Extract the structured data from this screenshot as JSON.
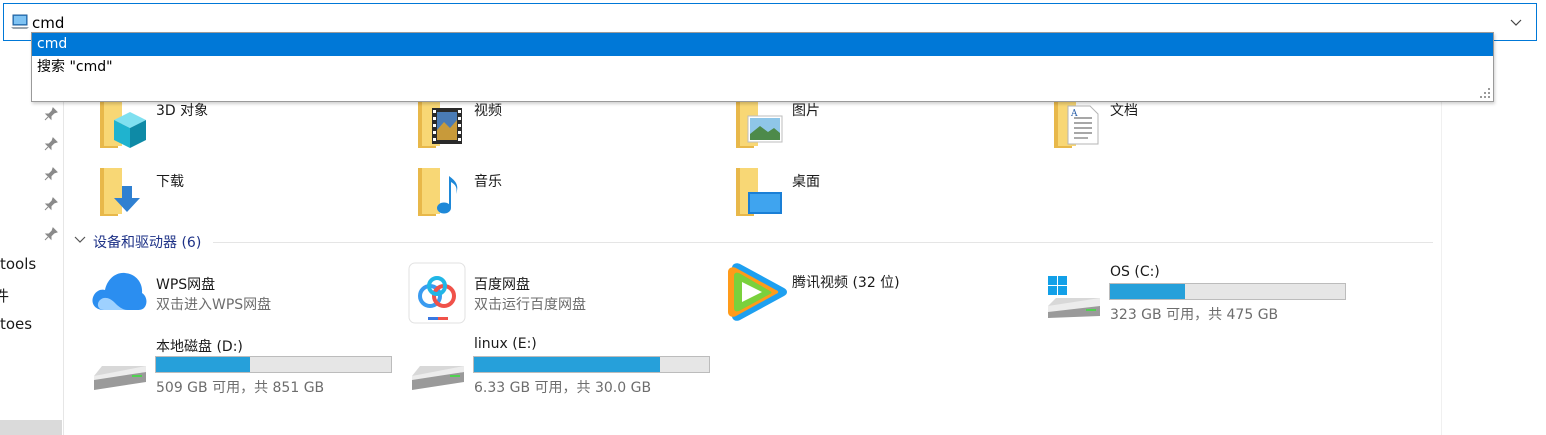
{
  "address_bar": {
    "value": "cmd",
    "icon": "computer-icon",
    "dropdown_icon": "chevron-down-icon"
  },
  "suggestions": [
    {
      "label": "cmd",
      "selected": true
    },
    {
      "label": "搜索 \"cmd\"",
      "selected": false
    }
  ],
  "nav": {
    "pinned_icon": "pin-icon",
    "items": [
      "tools",
      "件",
      "toes"
    ]
  },
  "folders": [
    {
      "label": "3D 对象",
      "icon": "folder-3d-objects-icon"
    },
    {
      "label": "视频",
      "icon": "folder-videos-icon"
    },
    {
      "label": "图片",
      "icon": "folder-pictures-icon"
    },
    {
      "label": "文档",
      "icon": "folder-documents-icon"
    },
    {
      "label": "下载",
      "icon": "folder-downloads-icon"
    },
    {
      "label": "音乐",
      "icon": "folder-music-icon"
    },
    {
      "label": "桌面",
      "icon": "folder-desktop-icon"
    }
  ],
  "devices_group": {
    "title": "设备和驱动器 (6)",
    "items": [
      {
        "label": "WPS网盘",
        "sub": "双击进入WPS网盘",
        "icon": "wps-cloud-icon"
      },
      {
        "label": "百度网盘",
        "sub": "双击运行百度网盘",
        "icon": "baidu-netdisk-icon"
      },
      {
        "label": "腾讯视频 (32 位)",
        "sub": "",
        "icon": "tencent-video-icon"
      },
      {
        "label": "OS (C:)",
        "sub": "323 GB 可用，共 475 GB",
        "icon": "windows-drive-icon",
        "used_fraction": 0.32
      },
      {
        "label": "本地磁盘 (D:)",
        "sub": "509 GB 可用，共 851 GB",
        "icon": "hard-drive-icon",
        "used_fraction": 0.4
      },
      {
        "label": "linux (E:)",
        "sub": "6.33 GB 可用，共 30.0 GB",
        "icon": "hard-drive-icon",
        "used_fraction": 0.79
      }
    ]
  },
  "colors": {
    "accent": "#0078d7",
    "bar_fill": "#26a0da",
    "group_title": "#1e3287"
  }
}
